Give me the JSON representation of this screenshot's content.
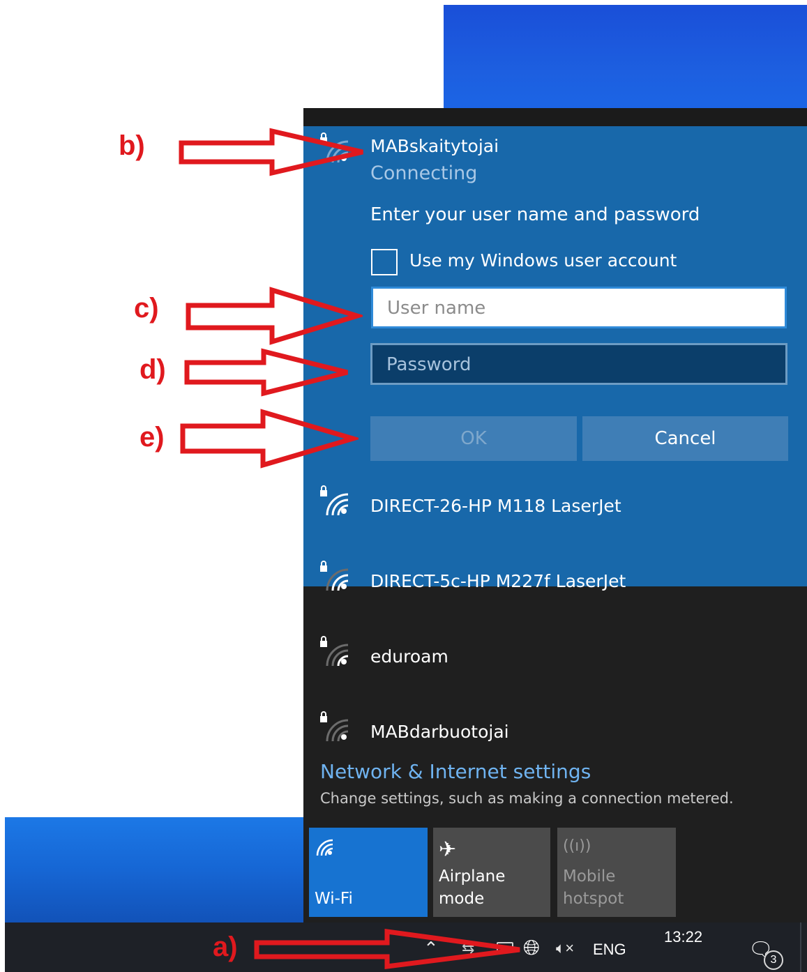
{
  "colors": {
    "accent": "#1868aa",
    "flyout_bg": "#1f1f1f",
    "annotation_red": "#e0191e",
    "link": "#6fb3f0"
  },
  "selected_network": {
    "name": "MABskaitytojai",
    "status": "Connecting",
    "prompt": "Enter your user name and password",
    "use_windows_account_label": "Use my Windows user account",
    "use_windows_account_checked": false,
    "username": {
      "value": "",
      "placeholder": "User name"
    },
    "password": {
      "value": "",
      "placeholder": "Password"
    },
    "ok_label": "OK",
    "cancel_label": "Cancel"
  },
  "networks": [
    {
      "name": "DIRECT-26-HP M118 LaserJet",
      "icon": "wifi-secured-icon"
    },
    {
      "name": "DIRECT-5c-HP M227f LaserJet",
      "icon": "wifi-secured-icon"
    },
    {
      "name": "eduroam",
      "icon": "wifi-secured-icon"
    },
    {
      "name": "MABdarbuotojai",
      "icon": "wifi-secured-icon"
    }
  ],
  "settings": {
    "link": "Network & Internet settings",
    "description": "Change settings, such as making a connection metered."
  },
  "quick_actions": [
    {
      "label": "Wi-Fi",
      "icon": "wifi-icon",
      "active": true
    },
    {
      "label": "Airplane mode",
      "icon": "airplane-icon",
      "active": false
    },
    {
      "label": "Mobile hotspot",
      "icon": "hotspot-icon",
      "active": false,
      "disabled": true
    }
  ],
  "taskbar": {
    "language": "ENG",
    "time": "13:22",
    "notification_count": "3"
  },
  "annotations": {
    "a": "a)",
    "b": "b)",
    "c": "c)",
    "d": "d)",
    "e": "e)"
  }
}
